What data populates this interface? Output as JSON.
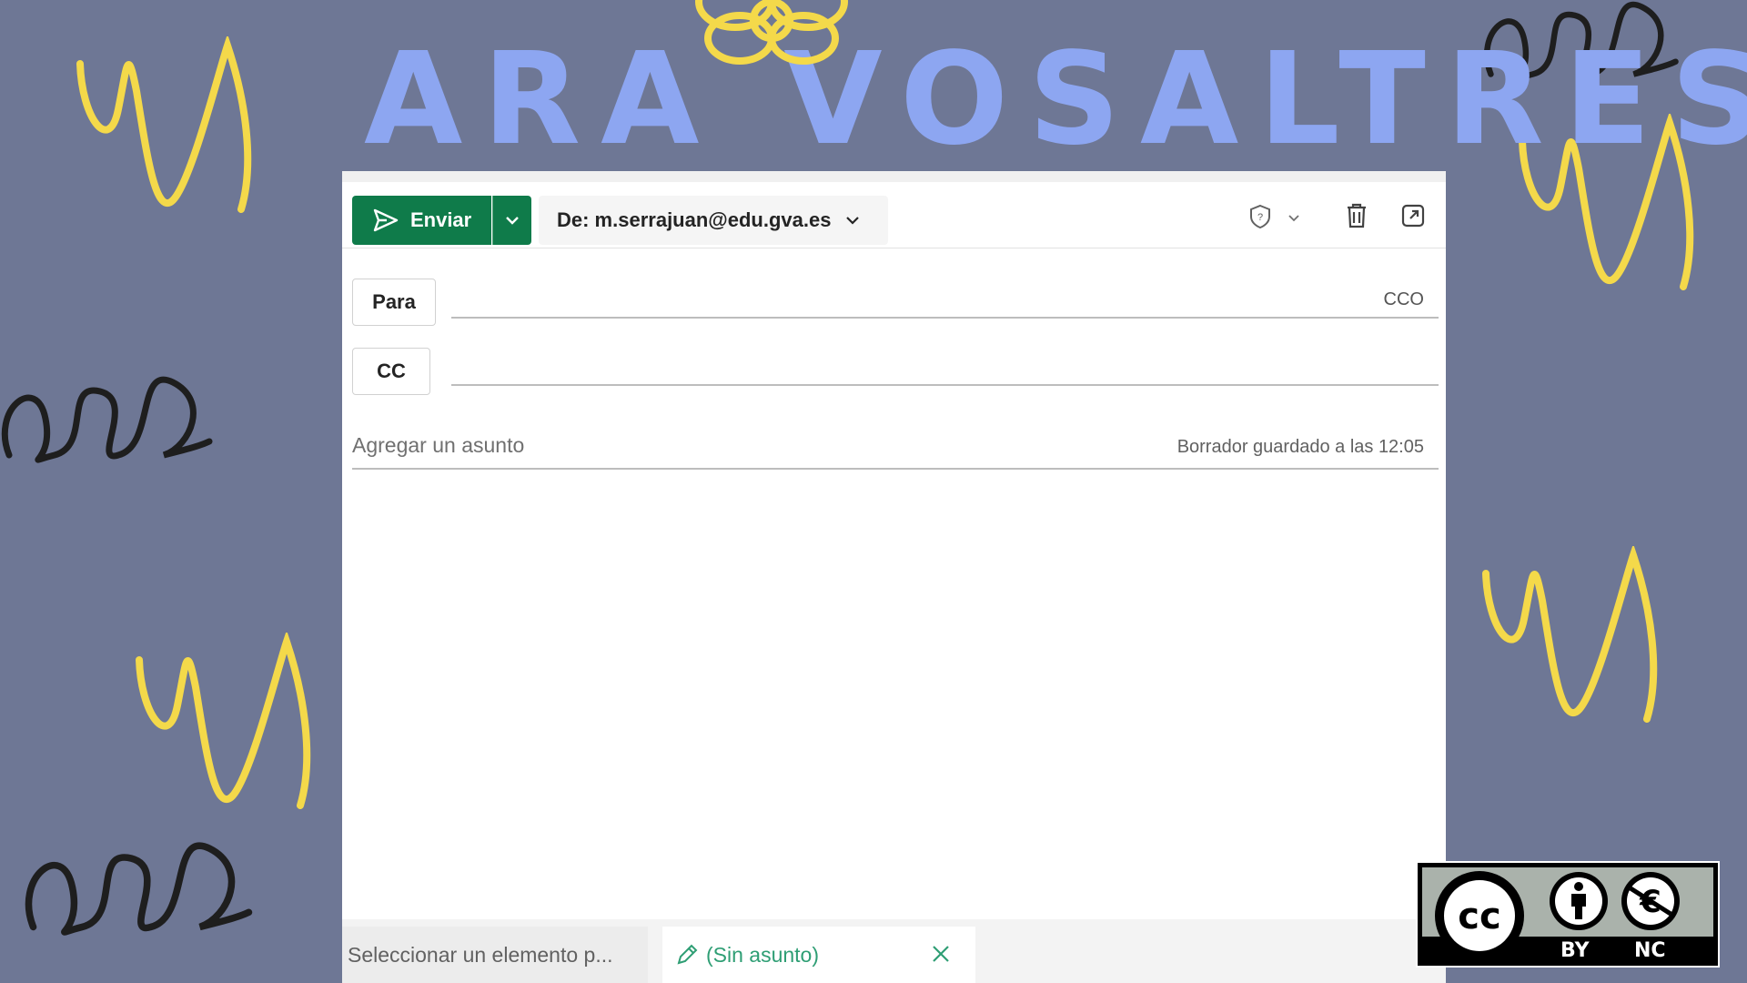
{
  "banner": {
    "title": "ARA VOSALTRES",
    "colors": {
      "background": "#6e7795",
      "title": "#8da6f1",
      "yellow_doodle": "#f4d94a",
      "black_doodle": "#1e1e1e"
    }
  },
  "compose": {
    "toolbar": {
      "send_label": "Enviar",
      "from_label": "De: m.serrajuan@edu.gva.es",
      "icons": [
        "send-icon",
        "chevron-down-icon",
        "shield-icon",
        "trash-icon",
        "popout-icon"
      ]
    },
    "to_label": "Para",
    "cc_label": "CC",
    "bcc_link": "CCO",
    "subject_placeholder": "Agregar un asunto",
    "draft_status": "Borrador guardado a las 12:05",
    "accent_color": "#0f7b4a"
  },
  "bottom_tabs": {
    "tab1_label": "Seleccionar un elemento p...",
    "tab2_label": "(Sin asunto)"
  },
  "license": {
    "cc": "cc",
    "by": "BY",
    "nc": "NC"
  }
}
